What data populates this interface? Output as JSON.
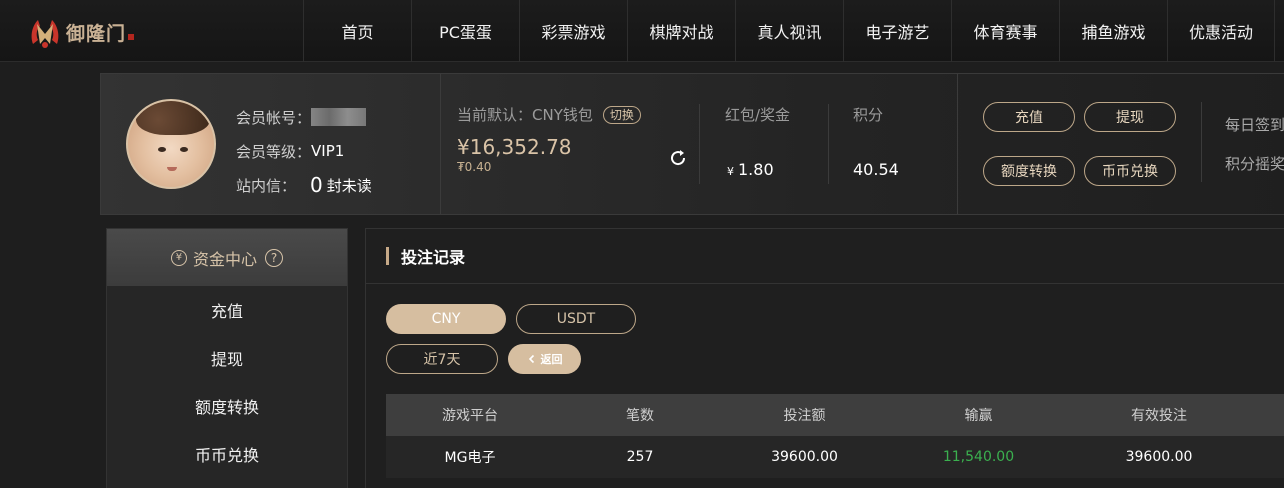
{
  "brand": {
    "logo_text": "御隆门"
  },
  "nav": [
    "首页",
    "PC蛋蛋",
    "彩票游戏",
    "棋牌对战",
    "真人视讯",
    "电子游艺",
    "体育赛事",
    "捕鱼游戏",
    "优惠活动"
  ],
  "user": {
    "account_label": "会员帐号：",
    "level_label": "会员等级：",
    "level_value": "VIP1",
    "inbox_label": "站内信：",
    "inbox_count": "0",
    "inbox_suffix": "封未读"
  },
  "wallet": {
    "default_label": "当前默认：CNY钱包",
    "switch_label": "切换",
    "balance": "¥16,352.78",
    "sub_balance": "₮0.40"
  },
  "bonus": {
    "label": "红包/奖金",
    "currency": "¥",
    "value": "1.80"
  },
  "points": {
    "label": "积分",
    "value": "40.54"
  },
  "actions": {
    "deposit": "充值",
    "withdraw": "提现",
    "transfer": "额度转换",
    "exchange": "币币兑换"
  },
  "side_links": {
    "daily_checkin": "每日签到",
    "points_lottery": "积分摇奖"
  },
  "sidebar": {
    "title": "资金中心",
    "coin_symbol": "¥",
    "help_symbol": "?",
    "items": [
      "充值",
      "提现",
      "额度转换",
      "币币兑换"
    ]
  },
  "main": {
    "title": "投注记录",
    "currency_tabs": [
      "CNY",
      "USDT"
    ],
    "period": "近7天",
    "back_label": "返回"
  },
  "table": {
    "headers": [
      "游戏平台",
      "笔数",
      "投注额",
      "输赢",
      "有效投注"
    ],
    "rows": [
      {
        "platform": "MG电子",
        "count": "257",
        "bet": "39600.00",
        "win_loss": "11,540.00",
        "valid_bet": "39600.00"
      }
    ]
  },
  "colors": {
    "accent": "#d6bea0",
    "win": "#3bb04f",
    "background": "#1e1e1e"
  }
}
